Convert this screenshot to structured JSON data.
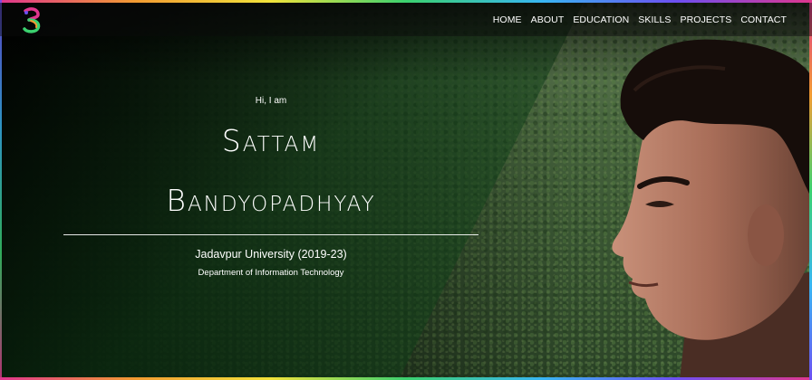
{
  "brand": {
    "logo_icon": "stylized-s-logo-icon",
    "accent_colors": [
      "#e0368d",
      "#f29b32",
      "#3bd16f",
      "#38b6f2",
      "#6d4ff2"
    ]
  },
  "nav": {
    "items": [
      {
        "label": "HOME"
      },
      {
        "label": "ABOUT"
      },
      {
        "label": "EDUCATION"
      },
      {
        "label": "SKILLS"
      },
      {
        "label": "PROJECTS"
      },
      {
        "label": "CONTACT"
      }
    ]
  },
  "hero": {
    "greeting": "Hi, I am",
    "first_name": "Sattam",
    "last_name": "Bandyopadhyay",
    "university": "Jadavpur University (2019-23)",
    "department": "Department of Information Technology"
  }
}
